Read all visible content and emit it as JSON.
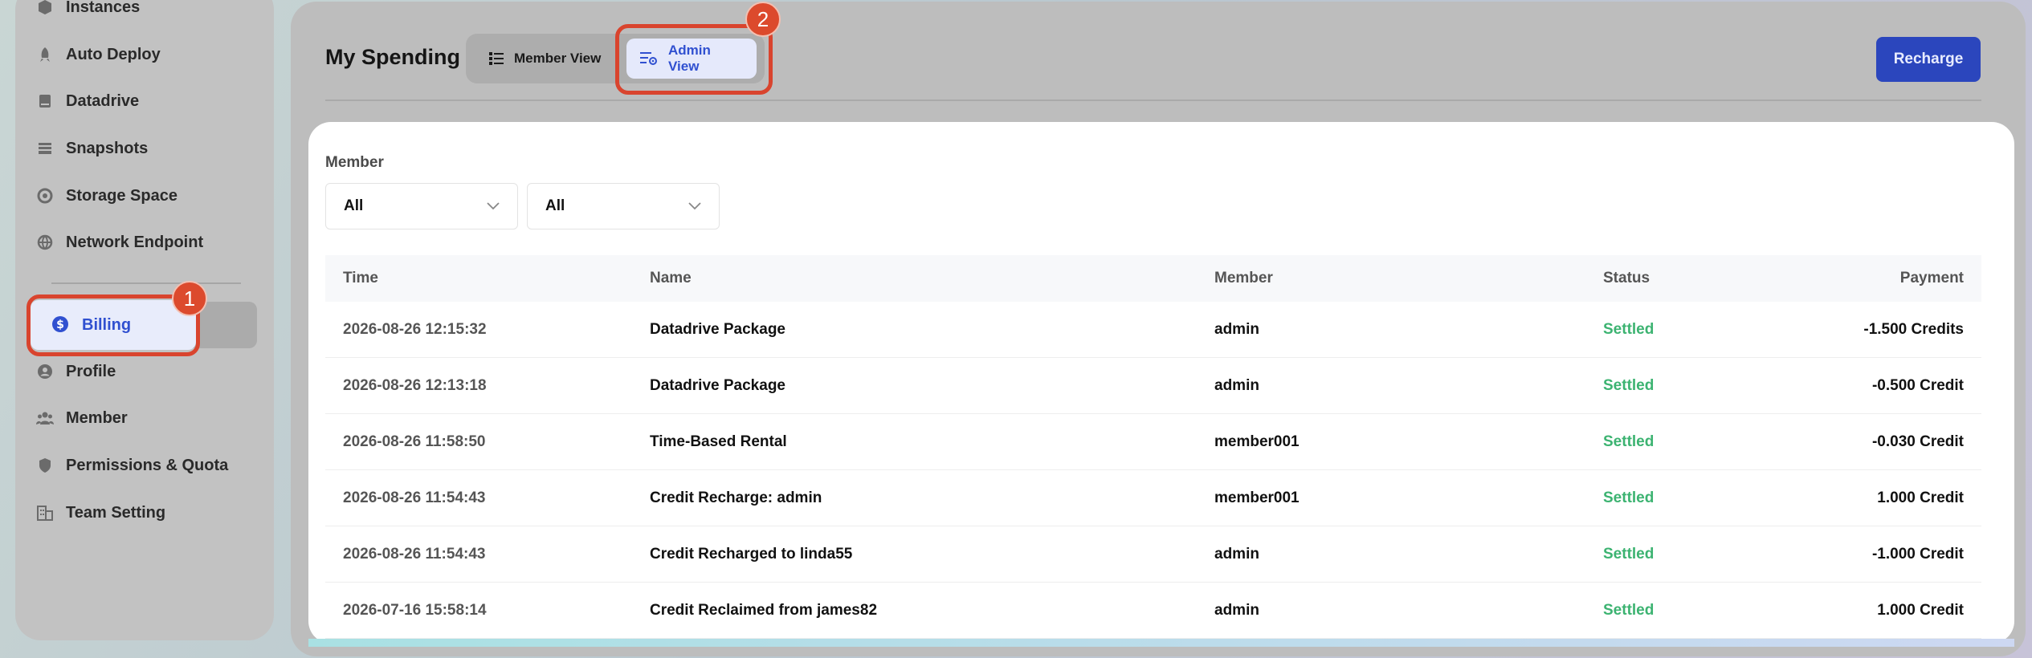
{
  "sidebar": {
    "items": [
      {
        "label": "Instances",
        "icon": "cube-icon"
      },
      {
        "label": "Auto Deploy",
        "icon": "rocket-icon"
      },
      {
        "label": "Datadrive",
        "icon": "drive-icon"
      },
      {
        "label": "Snapshots",
        "icon": "layers-icon"
      },
      {
        "label": "Storage Space",
        "icon": "disk-icon"
      },
      {
        "label": "Network Endpoint",
        "icon": "globe-icon"
      },
      {
        "label": "Billing",
        "icon": "dollar-circle-icon"
      },
      {
        "label": "Profile",
        "icon": "user-circle-icon"
      },
      {
        "label": "Member",
        "icon": "users-icon"
      },
      {
        "label": "Permissions & Quota",
        "icon": "shield-icon"
      },
      {
        "label": "Team Setting",
        "icon": "building-icon"
      }
    ]
  },
  "callouts": {
    "first": "1",
    "second": "2"
  },
  "header": {
    "title": "My Spending",
    "member_view": "Member View",
    "admin_view": "Admin View",
    "recharge": "Recharge"
  },
  "filters": {
    "label": "Member",
    "select1": "All",
    "select2": "All"
  },
  "table": {
    "headers": {
      "time": "Time",
      "name": "Name",
      "member": "Member",
      "status": "Status",
      "payment": "Payment"
    },
    "rows": [
      {
        "time": "2026-08-26 12:15:32",
        "name": "Datadrive Package",
        "member": "admin",
        "status": "Settled",
        "payment": "-1.500 Credits"
      },
      {
        "time": "2026-08-26 12:13:18",
        "name": "Datadrive Package",
        "member": "admin",
        "status": "Settled",
        "payment": "-0.500 Credit"
      },
      {
        "time": "2026-08-26 11:58:50",
        "name": "Time-Based Rental",
        "member": "member001",
        "status": "Settled",
        "payment": "-0.030 Credit"
      },
      {
        "time": "2026-08-26 11:54:43",
        "name": "Credit Recharge: admin",
        "member": "member001",
        "status": "Settled",
        "payment": "1.000 Credit"
      },
      {
        "time": "2026-08-26 11:54:43",
        "name": "Credit Recharged to linda55",
        "member": "admin",
        "status": "Settled",
        "payment": "-1.000 Credit"
      },
      {
        "time": "2026-07-16 15:58:14",
        "name": "Credit Reclaimed from james82",
        "member": "admin",
        "status": "Settled",
        "payment": "1.000 Credit"
      }
    ]
  },
  "colors": {
    "accent": "#2b46bd",
    "callout": "#dc4a2d",
    "settled": "#3cb371"
  }
}
